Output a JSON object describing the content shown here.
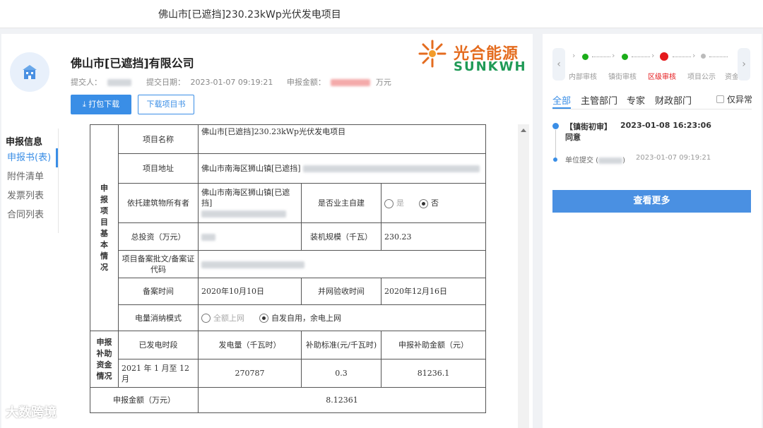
{
  "window": {
    "title": "佛山市[已遮挡]230.23kWp光伏发电项目"
  },
  "header": {
    "company": "佛山市[已遮挡]有限公司",
    "submitter_label": "提交人：",
    "submit_date_label": "提交日期：",
    "submit_date": "2023-01-07 09:19:21",
    "amount_label": "申报金额：",
    "amount_unit": "万元"
  },
  "logo": {
    "cn": "光合能源",
    "en": "SUNKWH"
  },
  "actions": {
    "download_pack": "打包下载",
    "download_project": "下载项目书"
  },
  "sidebar": {
    "title": "申报信息",
    "items": [
      {
        "label": "申报书(表)"
      },
      {
        "label": "附件清单"
      },
      {
        "label": "发票列表"
      },
      {
        "label": "合同列表"
      }
    ]
  },
  "form": {
    "section1": "申报项目基本情况",
    "section2": "申报补助资金情况",
    "project_name_label": "项目名称",
    "project_name": "佛山市[已遮挡]230.23kWp光伏发电项目",
    "address_label": "项目地址",
    "address": "佛山市南海区狮山镇[已遮挡]",
    "owner_label": "依托建筑物所有者",
    "owner": "佛山市南海区狮山镇[已遮挡]",
    "self_build_label": "是否业主自建",
    "opt_yes": "是",
    "opt_no": "否",
    "investment_label": "总投资（万元）",
    "capacity_label": "装机规模（千瓦）",
    "capacity": "230.23",
    "filing_code_label": "项目备案批文/备案证代码",
    "filing_time_label": "备案时间",
    "filing_time": "2020年10月10日",
    "grid_time_label": "并网验收时间",
    "grid_time": "2020年12月16日",
    "consumption_label": "电量消纳模式",
    "mode_full": "全额上网",
    "mode_self": "自发自用，余电上网",
    "period_label": "已发电时段",
    "generation_label": "发电量（千瓦时）",
    "subsidy_std_label": "补助标准(元/千瓦时)",
    "subsidy_amount_label": "申报补助金额（元）",
    "period_text": "2021 年 1  月至 12 月",
    "generation": "270787",
    "subsidy_std": "0.3",
    "subsidy_amount": "81236.1",
    "total_label": "申报金额（万元）",
    "total": "8.12361"
  },
  "watermark": "大数跨境",
  "progress": {
    "steps": [
      {
        "label": "内部审核",
        "status": "done"
      },
      {
        "label": "镇街审核",
        "status": "done"
      },
      {
        "label": "区级审核",
        "status": "current"
      },
      {
        "label": "项目公示",
        "status": "pending"
      },
      {
        "label": "资金",
        "status": "pending"
      }
    ]
  },
  "tabs": [
    {
      "label": "全部"
    },
    {
      "label": "主管部门"
    },
    {
      "label": "专家"
    },
    {
      "label": "财政部门"
    }
  ],
  "filter_label": "仅异常",
  "timeline": {
    "event1_title": "【镇街初审】",
    "event1_time": "2023-01-08 16:23:06",
    "event1_result": "同意",
    "event2_title": "单位提交 (",
    "event2_title_end": ")",
    "event2_time": "2023-01-07 09:19:21"
  },
  "more_button": "查看更多",
  "colors": {
    "accent": "#3a8ee6",
    "done": "#1aad19",
    "current": "#e5191c",
    "pending": "#bbbbbb"
  }
}
